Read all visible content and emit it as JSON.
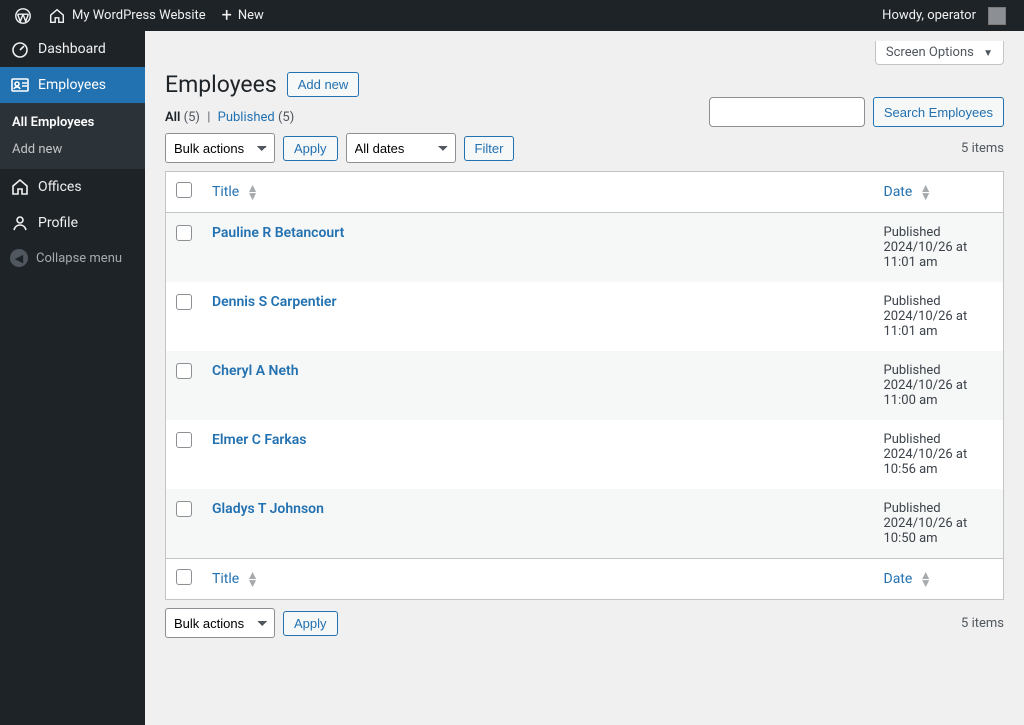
{
  "adminbar": {
    "site_name": "My WordPress Website",
    "new_label": "New",
    "howdy": "Howdy, operator"
  },
  "sidebar": {
    "dashboard": "Dashboard",
    "employees": "Employees",
    "sub_all_employees": "All Employees",
    "sub_add_new": "Add new",
    "offices": "Offices",
    "profile": "Profile",
    "collapse": "Collapse menu"
  },
  "screen_options_label": "Screen Options",
  "page_title": "Employees",
  "add_new_label": "Add new",
  "filters": {
    "all_label": "All",
    "all_count": "(5)",
    "published_label": "Published",
    "published_count": "(5)"
  },
  "search": {
    "placeholder": "",
    "button": "Search Employees"
  },
  "bulk_actions_label": "Bulk actions",
  "apply_label": "Apply",
  "all_dates_label": "All dates",
  "filter_label": "Filter",
  "items_count": "5 items",
  "columns": {
    "title": "Title",
    "date": "Date"
  },
  "rows": [
    {
      "title": "Pauline R Betancourt",
      "status": "Published",
      "datetime": "2024/10/26 at 11:01 am"
    },
    {
      "title": "Dennis S Carpentier",
      "status": "Published",
      "datetime": "2024/10/26 at 11:01 am"
    },
    {
      "title": "Cheryl A Neth",
      "status": "Published",
      "datetime": "2024/10/26 at 11:00 am"
    },
    {
      "title": "Elmer C Farkas",
      "status": "Published",
      "datetime": "2024/10/26 at 10:56 am"
    },
    {
      "title": "Gladys T Johnson",
      "status": "Published",
      "datetime": "2024/10/26 at 10:50 am"
    }
  ]
}
